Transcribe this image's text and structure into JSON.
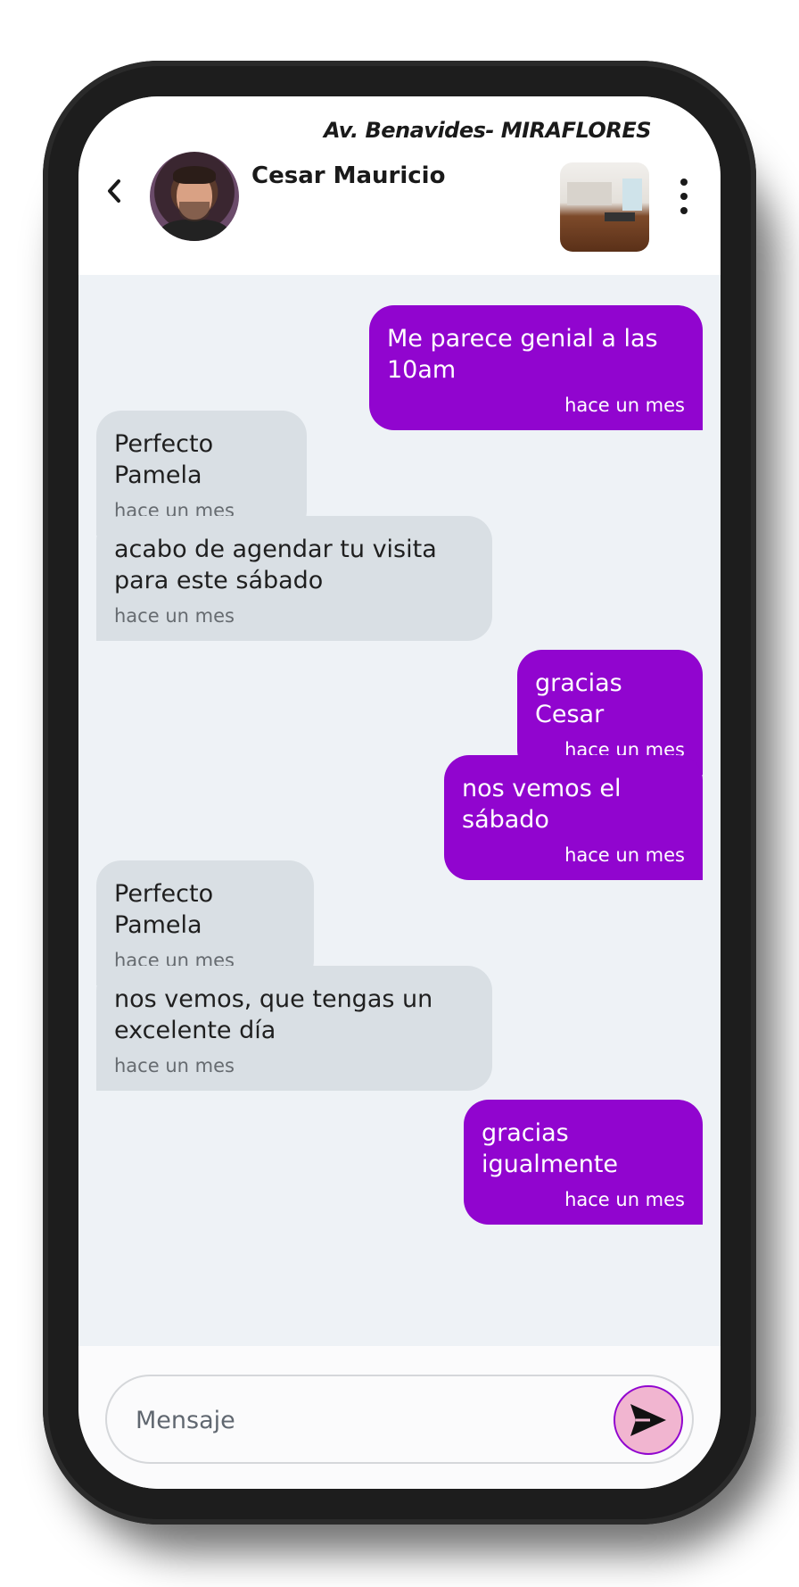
{
  "header": {
    "address": "Av. Benavides- MIRAFLORES",
    "contact_name": "Cesar Mauricio",
    "back_icon": "chevron-left-icon",
    "menu_icon": "more-vertical-icon"
  },
  "messages": [
    {
      "direction": "out",
      "text": "Me parece genial a las 10am",
      "time": "hace un mes"
    },
    {
      "direction": "in",
      "text": "Perfecto Pamela",
      "time": "hace un mes"
    },
    {
      "direction": "in",
      "text": "acabo de agendar tu visita para este sábado",
      "time": "hace un mes"
    },
    {
      "direction": "out",
      "text": "gracias Cesar",
      "time": "hace un mes"
    },
    {
      "direction": "out",
      "text": "nos vemos el sábado",
      "time": "hace un mes"
    },
    {
      "direction": "in",
      "text": "Perfecto Pamela",
      "time": "hace un mes"
    },
    {
      "direction": "in",
      "text": "nos vemos, que tengas un excelente día",
      "time": "hace un mes"
    },
    {
      "direction": "out",
      "text": "gracias igualmente",
      "time": "hace un mes"
    }
  ],
  "composer": {
    "placeholder": "Mensaje",
    "send_icon": "send-icon"
  },
  "colors": {
    "outgoing_bubble": "#9105cf",
    "incoming_bubble": "#d9dfe4",
    "chat_background": "#eef2f6",
    "send_button": "#f1b5d0"
  }
}
